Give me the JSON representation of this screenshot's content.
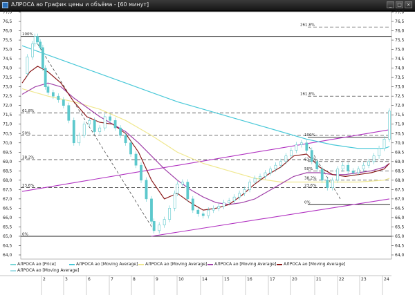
{
  "window": {
    "title": "АЛРОСА ао График цены и объёма - [60 минут]",
    "minimize_glyph": "_",
    "maximize_glyph": "□",
    "close_glyph": "×"
  },
  "legend": [
    {
      "label": "АЛРОСА ао [Price]",
      "color": "#7ad7d7"
    },
    {
      "label": "АЛРОСА ао [Moving Average]",
      "color": "#48c8d8"
    },
    {
      "label": "АЛРОСА ао [Moving Average]",
      "color": "#f0e890"
    },
    {
      "label": "АЛРОСА ао [Moving Average]",
      "color": "#a040a8"
    },
    {
      "label": "АЛРОСА ао [Moving Average]",
      "color": "#8b1a1a"
    },
    {
      "label": "АЛРОСА ао [Moving Average]",
      "color": "#a8e0e8"
    }
  ],
  "chart_data": {
    "type": "line",
    "ylim": [
      64.0,
      77.0
    ],
    "y_ticks": [
      "77,0",
      "76,5",
      "76,0",
      "75,5",
      "75,0",
      "74,5",
      "74,0",
      "73,5",
      "73,0",
      "72,5",
      "72,0",
      "71,5",
      "71,0",
      "70,5",
      "70,0",
      "69,5",
      "69,0",
      "68,5",
      "68,0",
      "67,5",
      "67,0",
      "66,5",
      "66,0",
      "65,5",
      "65,0",
      "64,5",
      "64,0"
    ],
    "x_ticks": [
      "2",
      "3",
      "6",
      "7",
      "8",
      "9",
      "10",
      "14",
      "15",
      "16",
      "17",
      "20",
      "21",
      "22",
      "23",
      "24"
    ],
    "x_count": 16,
    "price": [
      [
        0.0,
        73.7
      ],
      [
        0.2,
        74.6
      ],
      [
        0.4,
        75.3
      ],
      [
        0.5,
        75.7
      ],
      [
        0.6,
        75.4
      ],
      [
        0.7,
        75.1
      ],
      [
        0.8,
        74.0
      ],
      [
        0.9,
        73.0
      ],
      [
        1.0,
        72.7
      ],
      [
        1.2,
        72.5
      ],
      [
        1.4,
        72.3
      ],
      [
        1.6,
        72.0
      ],
      [
        1.8,
        71.2
      ],
      [
        2.0,
        70.0
      ],
      [
        2.2,
        70.4
      ],
      [
        2.4,
        71.0
      ],
      [
        2.6,
        71.2
      ],
      [
        2.8,
        70.6
      ],
      [
        3.0,
        70.8
      ],
      [
        3.2,
        71.4
      ],
      [
        3.4,
        71.2
      ],
      [
        3.6,
        70.8
      ],
      [
        3.8,
        70.4
      ],
      [
        4.0,
        70.0
      ],
      [
        4.2,
        69.4
      ],
      [
        4.4,
        68.8
      ],
      [
        4.6,
        68.0
      ],
      [
        4.8,
        67.0
      ],
      [
        5.0,
        65.8
      ],
      [
        5.1,
        65.3
      ],
      [
        5.3,
        65.6
      ],
      [
        5.5,
        65.9
      ],
      [
        5.7,
        66.5
      ],
      [
        5.9,
        67.3
      ],
      [
        6.0,
        67.8
      ],
      [
        6.2,
        67.9
      ],
      [
        6.4,
        67.0
      ],
      [
        6.6,
        66.4
      ],
      [
        6.8,
        66.2
      ],
      [
        7.0,
        66.1
      ],
      [
        7.2,
        66.4
      ],
      [
        7.4,
        66.5
      ],
      [
        7.6,
        66.6
      ],
      [
        7.8,
        66.8
      ],
      [
        8.0,
        66.9
      ],
      [
        8.2,
        67.1
      ],
      [
        8.4,
        67.3
      ],
      [
        8.6,
        67.5
      ],
      [
        8.8,
        67.9
      ],
      [
        9.0,
        68.1
      ],
      [
        9.2,
        68.2
      ],
      [
        9.4,
        68.4
      ],
      [
        9.6,
        68.6
      ],
      [
        9.8,
        68.8
      ],
      [
        10.0,
        69.0
      ],
      [
        10.2,
        69.3
      ],
      [
        10.4,
        69.6
      ],
      [
        10.6,
        69.9
      ],
      [
        10.8,
        70.0
      ],
      [
        11.0,
        69.6
      ],
      [
        11.2,
        69.0
      ],
      [
        11.4,
        68.6
      ],
      [
        11.6,
        68.0
      ],
      [
        11.8,
        67.6
      ],
      [
        12.0,
        68.0
      ],
      [
        12.2,
        68.6
      ],
      [
        12.4,
        68.8
      ],
      [
        12.6,
        68.5
      ],
      [
        12.8,
        68.4
      ],
      [
        13.0,
        68.6
      ],
      [
        13.2,
        68.8
      ],
      [
        13.4,
        69.0
      ],
      [
        13.6,
        69.3
      ],
      [
        13.8,
        69.7
      ],
      [
        14.0,
        70.2
      ],
      [
        14.2,
        71.7
      ]
    ],
    "ma_cyan": [
      [
        0.0,
        75.2
      ],
      [
        1.0,
        74.7
      ],
      [
        2.0,
        74.2
      ],
      [
        3.0,
        73.7
      ],
      [
        4.0,
        73.2
      ],
      [
        5.0,
        72.7
      ],
      [
        6.0,
        72.2
      ],
      [
        7.0,
        71.8
      ],
      [
        8.0,
        71.4
      ],
      [
        9.0,
        71.0
      ],
      [
        10.0,
        70.6
      ],
      [
        11.0,
        70.2
      ],
      [
        12.0,
        69.9
      ],
      [
        13.0,
        69.7
      ],
      [
        14.0,
        69.7
      ],
      [
        14.2,
        69.8
      ]
    ],
    "ma_yellow": [
      [
        0.0,
        72.9
      ],
      [
        1.0,
        72.5
      ],
      [
        2.0,
        72.2
      ],
      [
        3.0,
        71.8
      ],
      [
        4.0,
        71.2
      ],
      [
        5.0,
        70.4
      ],
      [
        6.0,
        69.5
      ],
      [
        7.0,
        68.9
      ],
      [
        8.0,
        68.5
      ],
      [
        9.0,
        68.1
      ],
      [
        10.0,
        67.9
      ],
      [
        11.0,
        67.9
      ],
      [
        12.0,
        67.9
      ],
      [
        13.0,
        67.9
      ],
      [
        14.0,
        68.0
      ],
      [
        14.2,
        68.1
      ]
    ],
    "ma_purple": [
      [
        0.0,
        72.6
      ],
      [
        0.5,
        73.0
      ],
      [
        1.0,
        73.2
      ],
      [
        1.5,
        73.0
      ],
      [
        2.0,
        72.4
      ],
      [
        2.5,
        71.9
      ],
      [
        3.0,
        71.4
      ],
      [
        3.5,
        71.0
      ],
      [
        4.0,
        70.6
      ],
      [
        4.5,
        70.0
      ],
      [
        5.0,
        69.3
      ],
      [
        5.5,
        68.6
      ],
      [
        6.0,
        68.0
      ],
      [
        6.5,
        67.5
      ],
      [
        7.0,
        67.1
      ],
      [
        7.5,
        66.8
      ],
      [
        8.0,
        66.7
      ],
      [
        8.5,
        66.8
      ],
      [
        9.0,
        67.0
      ],
      [
        9.5,
        67.4
      ],
      [
        10.0,
        67.8
      ],
      [
        10.5,
        68.2
      ],
      [
        11.0,
        68.4
      ],
      [
        11.5,
        68.4
      ],
      [
        12.0,
        68.3
      ],
      [
        12.5,
        68.3
      ],
      [
        13.0,
        68.4
      ],
      [
        13.5,
        68.5
      ],
      [
        14.0,
        68.7
      ],
      [
        14.2,
        68.9
      ]
    ],
    "ma_red": [
      [
        0.0,
        73.2
      ],
      [
        0.3,
        73.8
      ],
      [
        0.6,
        74.1
      ],
      [
        1.0,
        73.8
      ],
      [
        1.5,
        73.2
      ],
      [
        2.0,
        72.2
      ],
      [
        2.5,
        71.4
      ],
      [
        3.0,
        71.1
      ],
      [
        3.5,
        71.0
      ],
      [
        4.0,
        70.5
      ],
      [
        4.5,
        69.5
      ],
      [
        5.0,
        68.0
      ],
      [
        5.5,
        67.0
      ],
      [
        6.0,
        67.3
      ],
      [
        6.5,
        66.8
      ],
      [
        7.0,
        66.4
      ],
      [
        7.5,
        66.5
      ],
      [
        8.0,
        66.7
      ],
      [
        8.5,
        67.2
      ],
      [
        9.0,
        67.8
      ],
      [
        9.5,
        68.3
      ],
      [
        10.0,
        68.7
      ],
      [
        10.5,
        69.3
      ],
      [
        11.0,
        69.4
      ],
      [
        11.5,
        68.7
      ],
      [
        12.0,
        68.3
      ],
      [
        12.5,
        68.2
      ],
      [
        13.0,
        68.3
      ],
      [
        13.5,
        68.4
      ],
      [
        14.0,
        68.6
      ],
      [
        14.2,
        68.9
      ]
    ],
    "channel_upper": [
      [
        0.0,
        67.4
      ],
      [
        14.2,
        70.7
      ]
    ],
    "channel_lower": [
      [
        5.0,
        65.0
      ],
      [
        14.2,
        67.0
      ]
    ],
    "trend_dashed": [
      [
        0.6,
        75.3
      ],
      [
        5.1,
        65.3
      ]
    ],
    "trend_dashed_2": [
      [
        11.0,
        70.0
      ],
      [
        12.3,
        67.0
      ]
    ],
    "fib_left": {
      "levels": [
        {
          "label": "100%",
          "value": 75.7
        },
        {
          "label": "61.8%",
          "value": 71.6
        },
        {
          "label": "50%",
          "value": 70.4
        },
        {
          "label": "38.2%",
          "value": 69.1
        },
        {
          "label": "23.6%",
          "value": 67.6
        },
        {
          "label": "0%",
          "value": 65.0
        }
      ]
    },
    "fib_right": {
      "levels": [
        {
          "label": "261.8%",
          "value": 76.2
        },
        {
          "label": "161.8%",
          "value": 72.5
        },
        {
          "label": "100%",
          "value": 70.3
        },
        {
          "label": "61.8%",
          "value": 69.0
        },
        {
          "label": "50%",
          "value": 68.5
        },
        {
          "label": "38.2%",
          "value": 68.0
        },
        {
          "label": "23.6%",
          "value": 67.6
        },
        {
          "label": "0%",
          "value": 66.7
        }
      ]
    }
  }
}
